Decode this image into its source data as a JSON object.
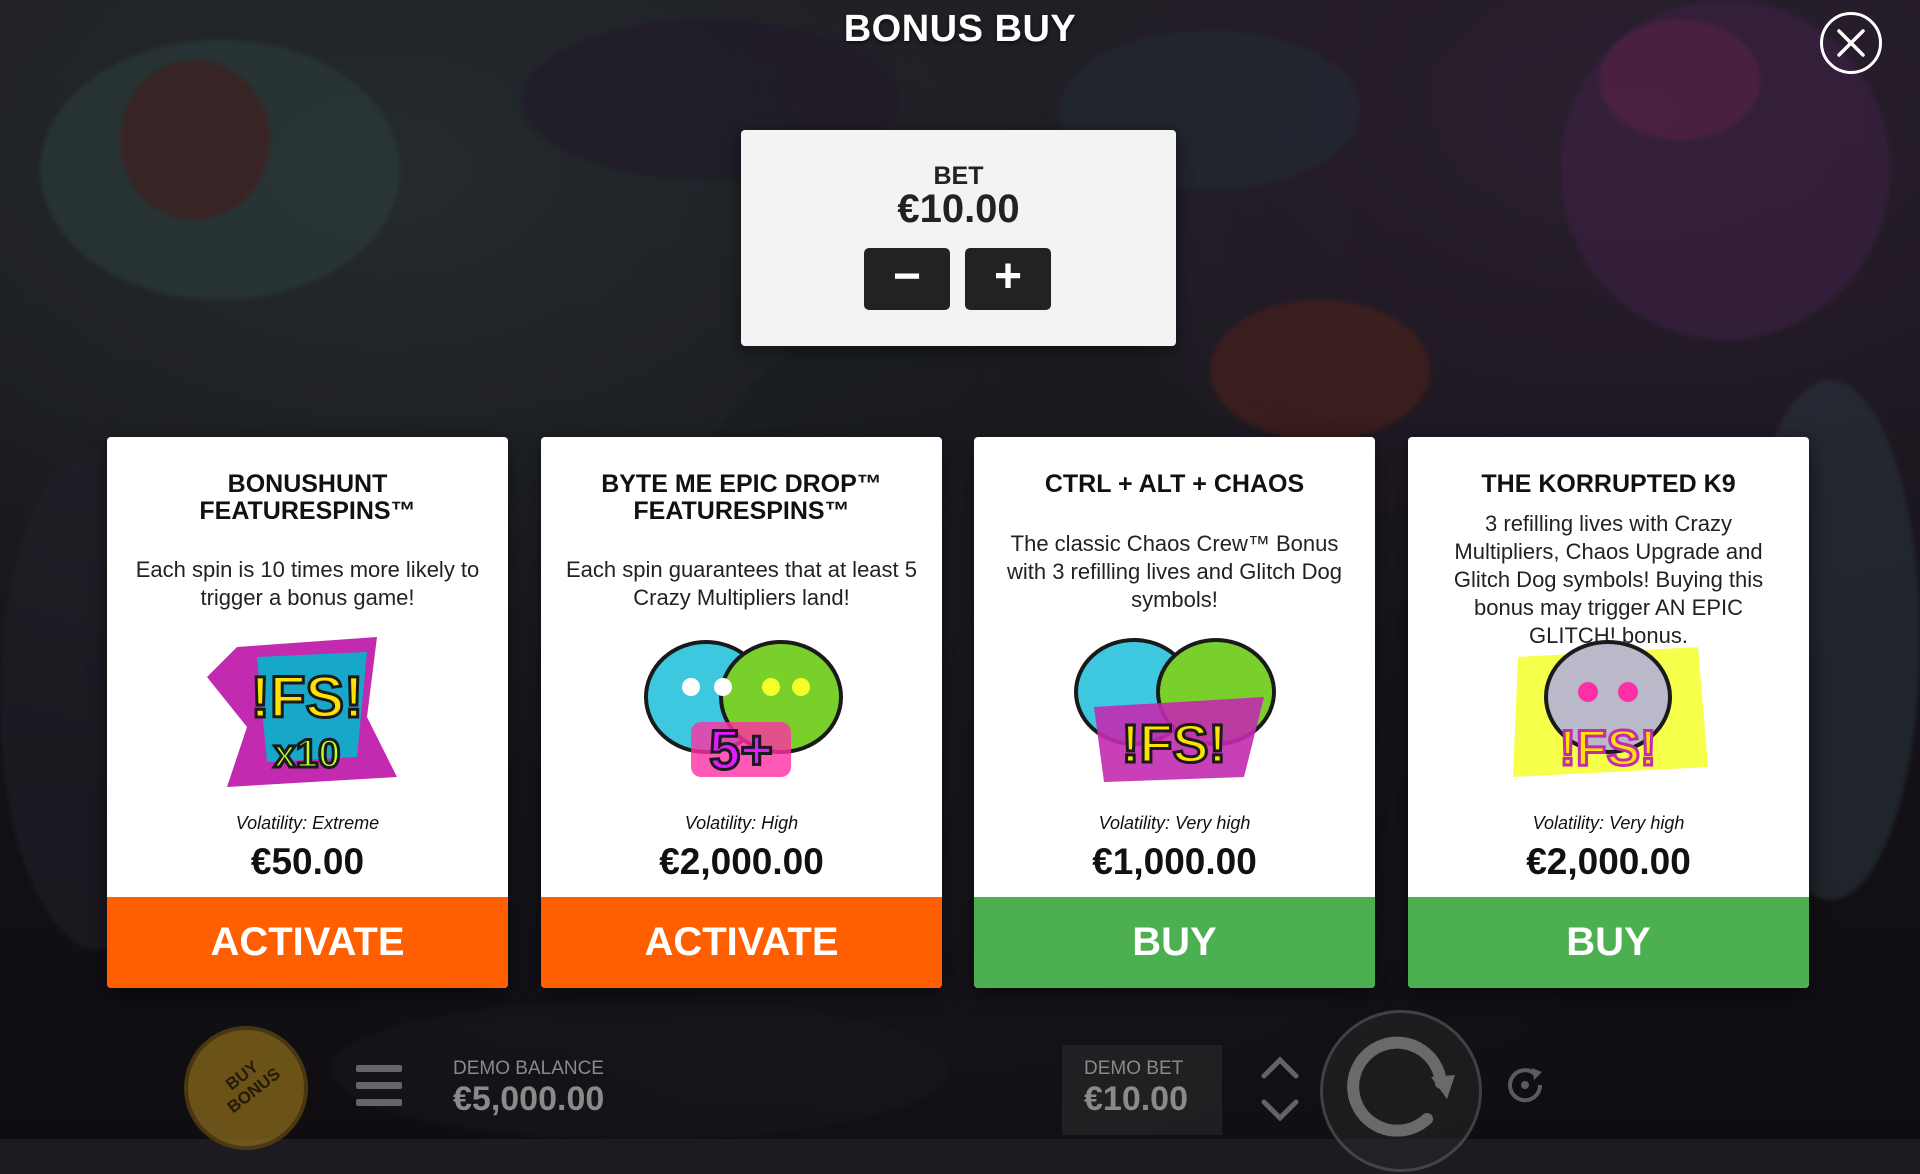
{
  "header": {
    "title": "BONUS BUY",
    "close_icon": "close-icon"
  },
  "bet": {
    "label": "BET",
    "value": "€10.00",
    "decrease_label": "−",
    "increase_label": "+"
  },
  "cards": [
    {
      "title": "BONUSHUNT FEATURESPINS™",
      "description": "Each spin is 10 times more likely to trigger a bonus game!",
      "image_text": "!FS!",
      "image_subtext": "x10",
      "volatility": "Volatility: Extreme",
      "price": "€50.00",
      "button": "ACTIVATE",
      "button_color": "#ff5f00"
    },
    {
      "title": "BYTE ME EPIC DROP™ FEATURESPINS™",
      "description": "Each spin guarantees that at least 5 Crazy Multipliers land!",
      "image_text": "5+",
      "volatility": "Volatility: High",
      "price": "€2,000.00",
      "button": "ACTIVATE",
      "button_color": "#ff5f00"
    },
    {
      "title": "CTRL + ALT + CHAOS",
      "description": "The classic Chaos Crew™ Bonus with 3 refilling lives and Glitch Dog symbols!",
      "image_text": "!FS!",
      "volatility": "Volatility: Very high",
      "price": "€1,000.00",
      "button": "BUY",
      "button_color": "#4caf50"
    },
    {
      "title": "THE KORRUPTED K9",
      "description": "3 refilling lives with Crazy Multipliers, Chaos Upgrade and Glitch Dog symbols! Buying this bonus may trigger AN EPIC GLITCH! bonus.",
      "image_text": "!FS!",
      "volatility": "Volatility: Very high",
      "price": "€2,000.00",
      "button": "BUY",
      "button_color": "#4caf50"
    }
  ],
  "bottom_bar": {
    "buy_bonus_label": "BUY BONUS",
    "balance_label": "DEMO BALANCE",
    "balance_value": "€5,000.00",
    "bet_label": "DEMO BET",
    "bet_value": "€10.00",
    "icons": [
      "menu-icon",
      "bet-arrows-icon",
      "spin-icon",
      "autoplay-icon"
    ]
  },
  "colors": {
    "activate": "#ff5f00",
    "buy": "#4caf50",
    "card_bg": "#ffffff"
  }
}
